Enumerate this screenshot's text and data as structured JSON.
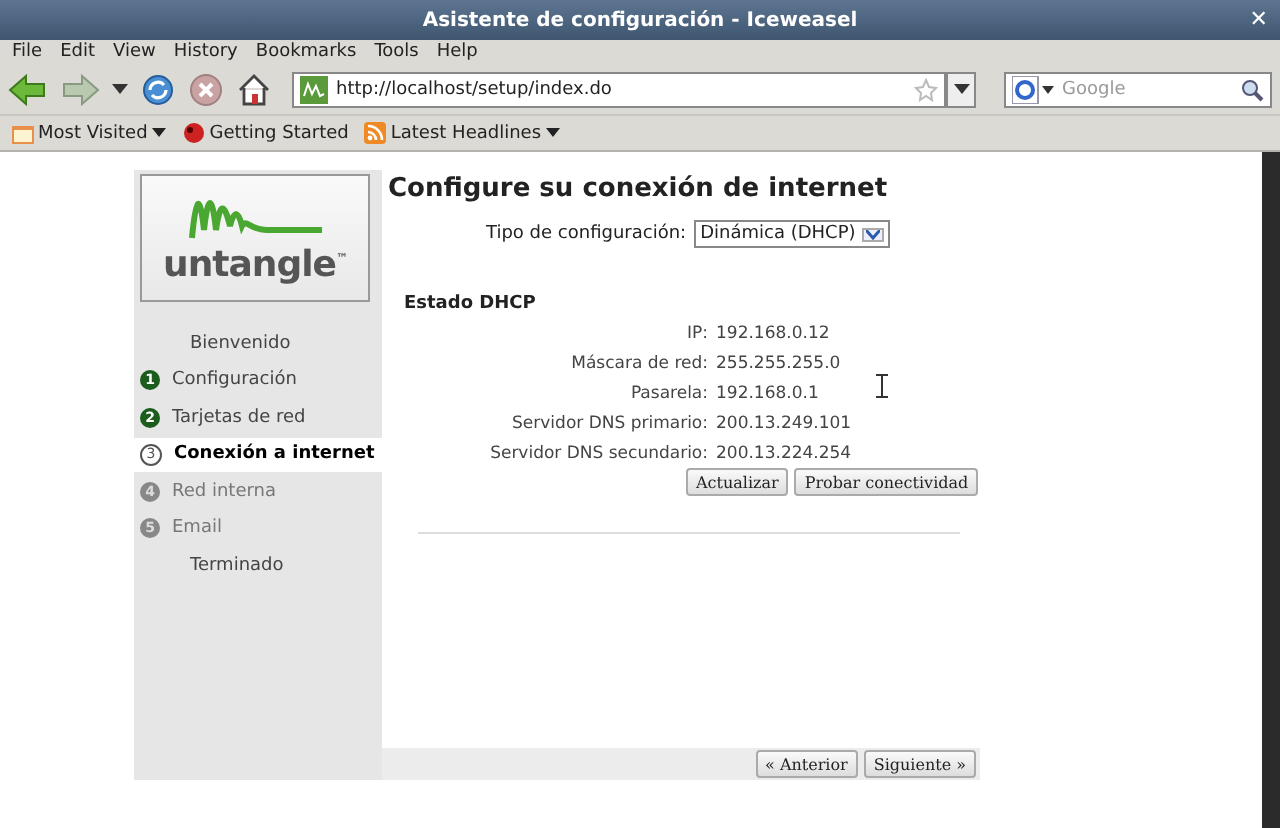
{
  "window": {
    "title": "Asistente de configuración - Iceweasel",
    "close": "✕"
  },
  "menu": [
    "File",
    "Edit",
    "View",
    "History",
    "Bookmarks",
    "Tools",
    "Help"
  ],
  "address": {
    "value": "http://localhost/setup/index.do"
  },
  "search": {
    "placeholder": "Google"
  },
  "bookmarks": [
    {
      "label": "Most Visited",
      "kind": "folder",
      "dropdown": true
    },
    {
      "label": "Getting Started",
      "kind": "page",
      "dropdown": false
    },
    {
      "label": "Latest Headlines",
      "kind": "feed",
      "dropdown": true
    }
  ],
  "steps": [
    {
      "label": "Bienvenido",
      "kind": "plain"
    },
    {
      "label": "Configuración",
      "number": "1",
      "kind": "done"
    },
    {
      "label": "Tarjetas de red",
      "number": "2",
      "kind": "done"
    },
    {
      "label": "Conexión a internet",
      "number": "3",
      "kind": "current"
    },
    {
      "label": "Red interna",
      "number": "4",
      "kind": "pending"
    },
    {
      "label": "Email",
      "number": "5",
      "kind": "pending"
    },
    {
      "label": "Terminado",
      "kind": "plain"
    }
  ],
  "logo": {
    "text": "untangle",
    "mark": "™"
  },
  "heading": "Configure su conexión de internet",
  "config_type": {
    "label": "Tipo de configuración:",
    "value": "Dinámica (DHCP)"
  },
  "status_title": "Estado DHCP",
  "status_rows": [
    {
      "label": "IP:",
      "value": "192.168.0.12"
    },
    {
      "label": "Máscara de red:",
      "value": "255.255.255.0"
    },
    {
      "label": "Pasarela:",
      "value": "192.168.0.1"
    },
    {
      "label": "Servidor DNS primario:",
      "value": "200.13.249.101"
    },
    {
      "label": "Servidor DNS secundario:",
      "value": "200.13.224.254"
    }
  ],
  "actions": [
    "Actualizar",
    "Probar conectividad"
  ],
  "nav": [
    "« Anterior",
    "Siguiente »"
  ]
}
